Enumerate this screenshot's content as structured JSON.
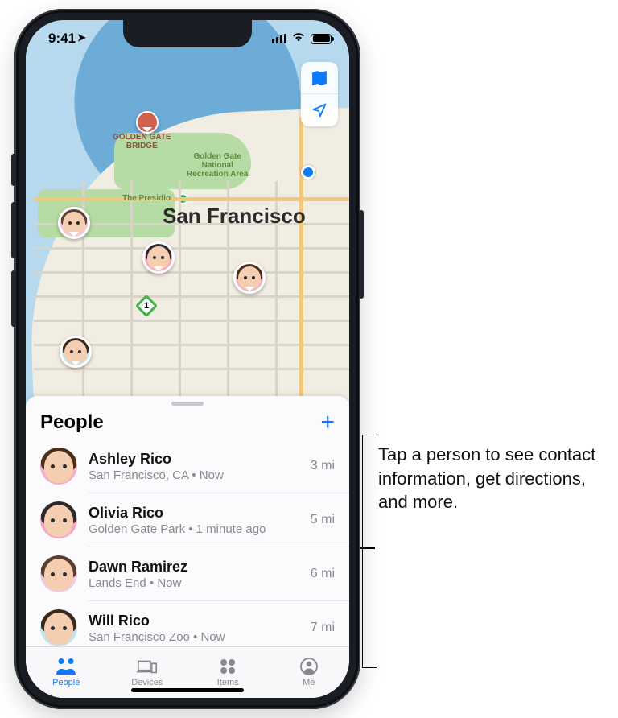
{
  "status": {
    "time": "9:41"
  },
  "map": {
    "city_label": "San Francisco",
    "presidio_label": "The Presidio",
    "ggra_label": "Golden Gate\nNational\nRecreation Area",
    "ggb_label": "GOLDEN GATE\nBRIDGE",
    "route1": "1"
  },
  "sheet": {
    "title": "People",
    "people": [
      {
        "name": "Ashley Rico",
        "sub": "San Francisco, CA • Now",
        "dist": "3 mi",
        "bg": "#f1b1c8",
        "hair": "#4a2d1a"
      },
      {
        "name": "Olivia Rico",
        "sub": "Golden Gate Park • 1 minute ago",
        "dist": "5 mi",
        "bg": "#f6a6c4",
        "hair": "#2b2b2b"
      },
      {
        "name": "Dawn Ramirez",
        "sub": "Lands End • Now",
        "dist": "6 mi",
        "bg": "#f0cbe6",
        "hair": "#5a402f"
      },
      {
        "name": "Will Rico",
        "sub": "San Francisco Zoo • Now",
        "dist": "7 mi",
        "bg": "#bfe7ef",
        "hair": "#3b2a1c"
      }
    ]
  },
  "tabs": {
    "people": "People",
    "devices": "Devices",
    "items": "Items",
    "me": "Me"
  },
  "callout": "Tap a person to see contact information, get directions, and more."
}
